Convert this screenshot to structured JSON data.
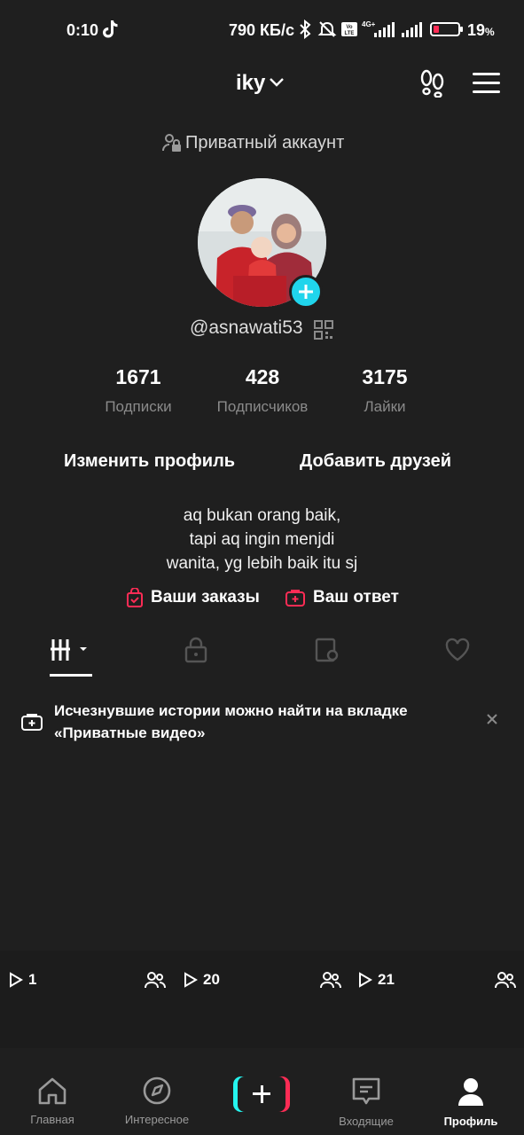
{
  "status_bar": {
    "time": "0:10",
    "speed": "790 КБ/с",
    "battery": "19",
    "battery_unit": "%",
    "network_label_top": "4G+",
    "volte_label": "Vo LTE"
  },
  "header": {
    "title": "iky"
  },
  "profile": {
    "private_label": "Приватный аккаунт",
    "username": "@asnawati53"
  },
  "stats": [
    {
      "value": "1671",
      "label": "Подписки"
    },
    {
      "value": "428",
      "label": "Подписчиков"
    },
    {
      "value": "3175",
      "label": "Лайки"
    }
  ],
  "actions": {
    "edit_profile": "Изменить профиль",
    "add_friends": "Добавить друзей"
  },
  "bio": {
    "line1": "aq bukan orang baik,",
    "line2": "tapi aq ingin menjdi",
    "line3": "wanita, yg lebih baik itu sj"
  },
  "links": {
    "orders": "Ваши заказы",
    "answer": "Ваш ответ"
  },
  "notice": {
    "text": "Исчезнувшие истории можно найти на вкладке «Приватные видео»"
  },
  "videos": [
    {
      "views": "1"
    },
    {
      "views": "20"
    },
    {
      "views": "21"
    }
  ],
  "nav": {
    "home": "Главная",
    "discover": "Интересное",
    "inbox": "Входящие",
    "profile": "Профиль"
  },
  "colors": {
    "background": "#1f1f1f",
    "accent_cyan": "#20d5ec",
    "accent_red": "#fe2c55"
  }
}
